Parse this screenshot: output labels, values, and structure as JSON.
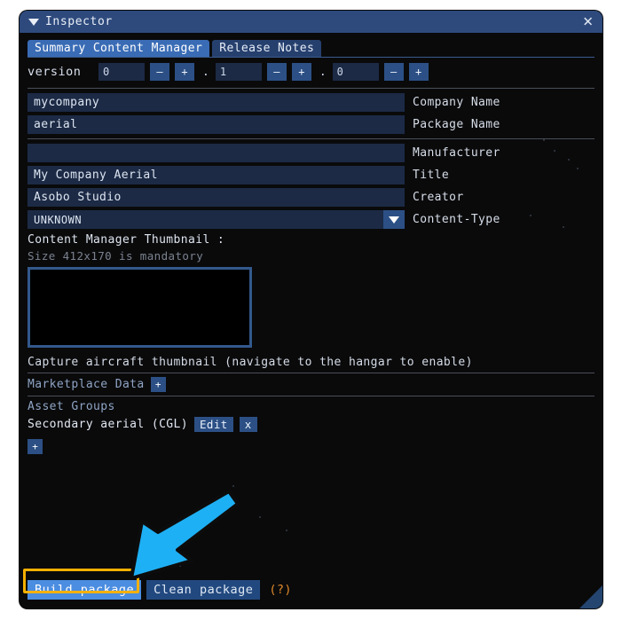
{
  "window": {
    "title": "Inspector",
    "collapse_icon": "caret-down-icon",
    "close_icon": "close-icon"
  },
  "tabs": [
    {
      "label": "Summary Content Manager",
      "active": true
    },
    {
      "label": "Release Notes",
      "active": false
    }
  ],
  "version": {
    "label": "version",
    "major": "0",
    "minor": "1",
    "patch": "0",
    "minus_label": "–",
    "plus_label": "+",
    "separator": "."
  },
  "fields": [
    {
      "value": "mycompany",
      "label": "Company Name",
      "type": "text"
    },
    {
      "value": "aerial",
      "label": "Package Name",
      "type": "text"
    },
    {
      "value": "",
      "label": "Manufacturer",
      "type": "text"
    },
    {
      "value": "My Company Aerial",
      "label": "Title",
      "type": "text"
    },
    {
      "value": "Asobo Studio",
      "label": "Creator",
      "type": "text"
    },
    {
      "value": "UNKNOWN",
      "label": "Content-Type",
      "type": "dropdown"
    }
  ],
  "thumbnail": {
    "title": "Content Manager Thumbnail :",
    "note": "Size 412x170 is mandatory",
    "capture_hint": "Capture aircraft thumbnail (navigate to the hangar to enable)"
  },
  "marketplace": {
    "label": "Marketplace Data",
    "add_label": "+"
  },
  "asset_groups": {
    "heading": "Asset Groups",
    "items": [
      {
        "name": "Secondary aerial (CGL)",
        "edit_label": "Edit",
        "remove_label": "x"
      }
    ],
    "add_label": "+"
  },
  "bottom_bar": {
    "build_label": "Build package",
    "clean_label": "Clean package",
    "help_label": "(?)"
  },
  "annotation": {
    "arrow_color": "#1eb0f5",
    "highlight_color": "#f5b000",
    "target": "Build package"
  },
  "colors": {
    "titlebar": "#2e4a7d",
    "accent_blue": "#3a6cb5",
    "field_bg": "#1c2a45",
    "panel_bg": "#0a0a0b",
    "button_blue": "#2c5085",
    "primary_button": "#4b8de0",
    "help_orange": "#e08a2a",
    "thumb_border": "#33598c"
  }
}
